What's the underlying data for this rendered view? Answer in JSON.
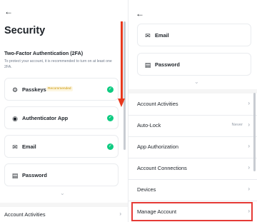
{
  "left": {
    "title": "Security",
    "twofa": {
      "heading": "Two-Factor Authentication (2FA)",
      "description": "To protect your account, it is recommended to turn on at least one 2FA."
    },
    "methods": [
      {
        "label": "Passkeys",
        "badge": "Recommended",
        "icon": "passkey-icon",
        "enabled": true
      },
      {
        "label": "Authenticator App",
        "icon": "authenticator-icon",
        "enabled": true
      },
      {
        "label": "Email",
        "icon": "email-icon",
        "enabled": true
      },
      {
        "label": "Password",
        "icon": "password-icon",
        "enabled": false
      }
    ],
    "items": [
      {
        "label": "Account Activities"
      }
    ]
  },
  "right": {
    "methods": [
      {
        "label": "Email",
        "icon": "email-icon"
      },
      {
        "label": "Password",
        "icon": "password-icon"
      }
    ],
    "items": [
      {
        "label": "Account Activities",
        "value": ""
      },
      {
        "label": "Auto-Lock",
        "value": "Never"
      },
      {
        "label": "App Authorization",
        "value": ""
      },
      {
        "label": "Account Connections",
        "value": ""
      },
      {
        "label": "Devices",
        "value": ""
      },
      {
        "label": "Manage Account",
        "value": ""
      }
    ]
  },
  "colors": {
    "check": "#0ecb81",
    "badge_text": "#c99400",
    "annotation_red": "#e8381d",
    "highlight_red": "#e53935"
  }
}
